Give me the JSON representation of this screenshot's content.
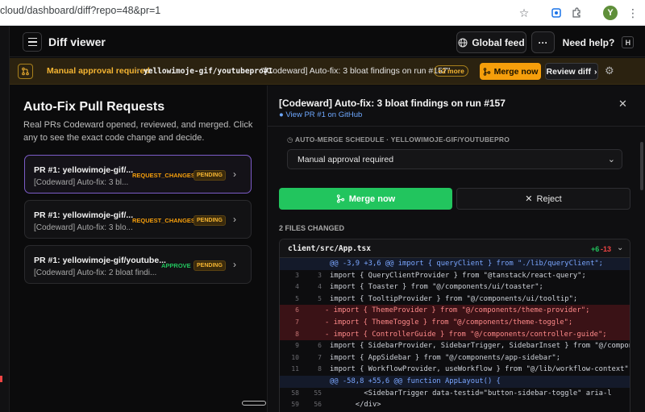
{
  "browser": {
    "url": "cloud/dashboard/diff?repo=48&pr=1",
    "avatar_letter": "Y"
  },
  "header": {
    "title": "Diff viewer",
    "global_feed": "Global feed",
    "more": "···",
    "need_help": "Need help?",
    "help_key": "H"
  },
  "banner": {
    "status": "Manual approval required",
    "separator": "•",
    "repo": "yellowimoje-gif/youtubepro#1",
    "pr_title": "\"[Codeward] Auto-fix: 3 bloat findings on run #157\"",
    "more_badge": "+2 more",
    "merge_now": "Merge now",
    "review_diff": "Review diff"
  },
  "left": {
    "title": "Auto-Fix Pull Requests",
    "description": "Real PRs Codeward opened, reviewed, and merged. Click any to see the exact code change and decide.",
    "cards": [
      {
        "title": "PR #1: yellowimoje-gif/...",
        "subtitle": "[Codeward] Auto-fix: 3 bl...",
        "status": "REQUEST_CHANGES",
        "badge": "PENDING"
      },
      {
        "title": "PR #1: yellowimoje-gif/...",
        "subtitle": "[Codeward] Auto-fix: 3 blo...",
        "status": "REQUEST_CHANGES",
        "badge": "PENDING"
      },
      {
        "title": "PR #1: yellowimoje-gif/youtube...",
        "subtitle": "[Codeward] Auto-fix: 2 bloat findi...",
        "status": "APPROVE",
        "badge": "PENDING"
      }
    ]
  },
  "right": {
    "title": "[Codeward] Auto-fix: 3 bloat findings on run #157",
    "github_link": "View PR #1 on GitHub",
    "schedule_label": "AUTO-MERGE SCHEDULE · YELLOWIMOJE-GIF/YOUTUBEPRO",
    "schedule_value": "Manual approval required",
    "merge_now": "Merge now",
    "reject": "Reject",
    "files_changed": "2 FILES CHANGED",
    "diff": {
      "file": "client/src/App.tsx",
      "additions": "+6",
      "deletions": "-13",
      "lines": [
        {
          "type": "hunk",
          "old": "",
          "new": "",
          "code": "@@ -3,9 +3,6 @@ import { queryClient } from \"./lib/queryClient\";"
        },
        {
          "type": "ctx",
          "old": "3",
          "new": "3",
          "code": "import { QueryClientProvider } from \"@tanstack/react-query\";"
        },
        {
          "type": "ctx",
          "old": "4",
          "new": "4",
          "code": "import { Toaster } from \"@/components/ui/toaster\";"
        },
        {
          "type": "ctx",
          "old": "5",
          "new": "5",
          "code": "import { TooltipProvider } from \"@/components/ui/tooltip\";"
        },
        {
          "type": "del",
          "old": "6",
          "new": "",
          "code": "- import { ThemeProvider } from \"@/components/theme-provider\";"
        },
        {
          "type": "del",
          "old": "7",
          "new": "",
          "code": "- import { ThemeToggle } from \"@/components/theme-toggle\";"
        },
        {
          "type": "del",
          "old": "8",
          "new": "",
          "code": "- import { ControllerGuide } from \"@/components/controller-guide\";"
        },
        {
          "type": "ctx",
          "old": "9",
          "new": "6",
          "code": "import { SidebarProvider, SidebarTrigger, SidebarInset } from \"@/compone"
        },
        {
          "type": "ctx",
          "old": "10",
          "new": "7",
          "code": "import { AppSidebar } from \"@/components/app-sidebar\";"
        },
        {
          "type": "ctx",
          "old": "11",
          "new": "8",
          "code": "import { WorkflowProvider, useWorkflow } from \"@/lib/workflow-context\";"
        },
        {
          "type": "hunk",
          "old": "",
          "new": "",
          "code": "@@ -58,8 +55,6 @@ function AppLayout() {"
        },
        {
          "type": "ctx",
          "old": "58",
          "new": "55",
          "code": "        <SidebarTrigger data-testid=\"button-sidebar-toggle\" aria-l"
        },
        {
          "type": "ctx",
          "old": "59",
          "new": "56",
          "code": "      </div>"
        }
      ]
    }
  },
  "colors": {
    "accent_green": "#22c55e",
    "accent_amber": "#f59e0b",
    "selected_border": "#7c5cc7",
    "link_blue": "#6ea8ff"
  }
}
